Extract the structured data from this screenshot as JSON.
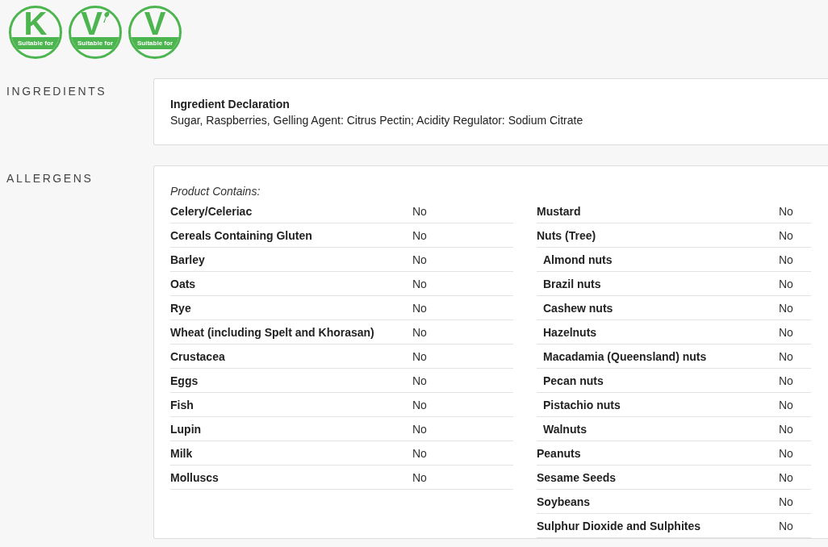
{
  "badges": [
    {
      "kind": "kosher",
      "letter": "K",
      "caption": "Suitable for"
    },
    {
      "kind": "vegan",
      "letter": "V",
      "caption": "Suitable for"
    },
    {
      "kind": "vegetarian",
      "letter": "V",
      "caption": "Suitable for"
    }
  ],
  "ingredients": {
    "label": "INGREDIENTS",
    "title": "Ingredient Declaration",
    "text": "Sugar, Raspberries, Gelling Agent: Citrus Pectin; Acidity Regulator: Sodium Citrate"
  },
  "allergens": {
    "label": "ALLERGENS",
    "heading": "Product Contains:",
    "columns": [
      [
        {
          "name": "Celery/Celeriac",
          "value": "No"
        },
        {
          "name": "Cereals Containing Gluten",
          "value": "No"
        },
        {
          "name": "Barley",
          "value": "No"
        },
        {
          "name": "Oats",
          "value": "No"
        },
        {
          "name": "Rye",
          "value": "No"
        },
        {
          "name": "Wheat (including Spelt and Khorasan)",
          "value": "No"
        },
        {
          "name": "Crustacea",
          "value": "No"
        },
        {
          "name": "Eggs",
          "value": "No"
        },
        {
          "name": "Fish",
          "value": "No"
        },
        {
          "name": "Lupin",
          "value": "No"
        },
        {
          "name": "Milk",
          "value": "No"
        },
        {
          "name": "Molluscs",
          "value": "No"
        }
      ],
      [
        {
          "name": "Mustard",
          "value": "No"
        },
        {
          "name": "Nuts (Tree)",
          "value": "No",
          "children": [
            {
              "name": "Almond nuts",
              "value": "No"
            },
            {
              "name": "Brazil nuts",
              "value": "No"
            },
            {
              "name": "Cashew nuts",
              "value": "No"
            },
            {
              "name": "Hazelnuts",
              "value": "No"
            },
            {
              "name": "Macadamia (Queensland) nuts",
              "value": "No"
            },
            {
              "name": "Pecan nuts",
              "value": "No"
            },
            {
              "name": "Pistachio nuts",
              "value": "No"
            },
            {
              "name": "Walnuts",
              "value": "No"
            }
          ]
        },
        {
          "name": "Peanuts",
          "value": "No"
        },
        {
          "name": "Sesame Seeds",
          "value": "No"
        },
        {
          "name": "Soybeans",
          "value": "No"
        },
        {
          "name": "Sulphur Dioxide and Sulphites",
          "value": "No"
        }
      ]
    ]
  }
}
